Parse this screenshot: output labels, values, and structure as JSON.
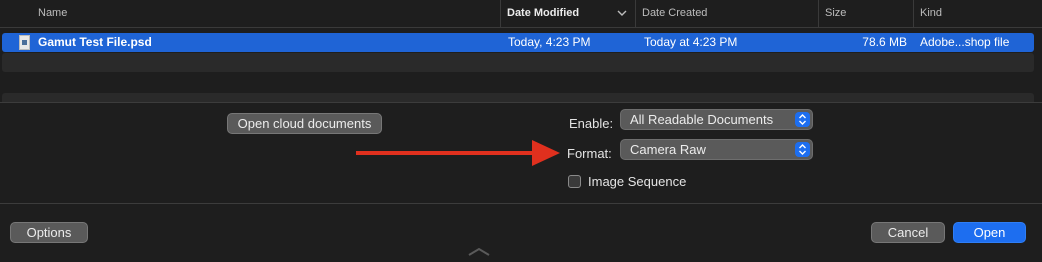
{
  "columns": {
    "name": "Name",
    "date_modified": "Date Modified",
    "date_created": "Date Created",
    "size": "Size",
    "kind": "Kind"
  },
  "files": [
    {
      "name": "Gamut Test File.psd",
      "date_modified": "Today, 4:23 PM",
      "date_created": "Today at 4:23 PM",
      "size": "78.6 MB",
      "kind": "Adobe...shop file"
    }
  ],
  "buttons": {
    "cloud": "Open cloud documents",
    "options": "Options",
    "cancel": "Cancel",
    "open": "Open"
  },
  "enable": {
    "label": "Enable:",
    "value": "All Readable Documents"
  },
  "format": {
    "label": "Format:",
    "value": "Camera Raw"
  },
  "image_sequence": {
    "label": "Image Sequence",
    "checked": false
  },
  "colors": {
    "accent": "#1d6ef0",
    "selection": "#1f64d6",
    "annotation_arrow": "#e0301e"
  },
  "icons": {
    "file": "psd-file-icon",
    "sort": "chevron-down-icon",
    "stepper": "up-down-chevron-icon",
    "resize": "resize-handle-icon"
  }
}
